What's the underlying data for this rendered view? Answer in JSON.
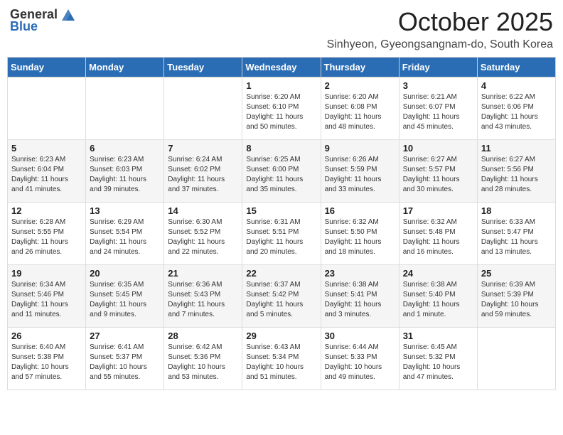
{
  "header": {
    "logo_general": "General",
    "logo_blue": "Blue",
    "month": "October 2025",
    "location": "Sinhyeon, Gyeongsangnam-do, South Korea"
  },
  "days_of_week": [
    "Sunday",
    "Monday",
    "Tuesday",
    "Wednesday",
    "Thursday",
    "Friday",
    "Saturday"
  ],
  "weeks": [
    [
      {
        "day": "",
        "info": ""
      },
      {
        "day": "",
        "info": ""
      },
      {
        "day": "",
        "info": ""
      },
      {
        "day": "1",
        "info": "Sunrise: 6:20 AM\nSunset: 6:10 PM\nDaylight: 11 hours\nand 50 minutes."
      },
      {
        "day": "2",
        "info": "Sunrise: 6:20 AM\nSunset: 6:08 PM\nDaylight: 11 hours\nand 48 minutes."
      },
      {
        "day": "3",
        "info": "Sunrise: 6:21 AM\nSunset: 6:07 PM\nDaylight: 11 hours\nand 45 minutes."
      },
      {
        "day": "4",
        "info": "Sunrise: 6:22 AM\nSunset: 6:06 PM\nDaylight: 11 hours\nand 43 minutes."
      }
    ],
    [
      {
        "day": "5",
        "info": "Sunrise: 6:23 AM\nSunset: 6:04 PM\nDaylight: 11 hours\nand 41 minutes."
      },
      {
        "day": "6",
        "info": "Sunrise: 6:23 AM\nSunset: 6:03 PM\nDaylight: 11 hours\nand 39 minutes."
      },
      {
        "day": "7",
        "info": "Sunrise: 6:24 AM\nSunset: 6:02 PM\nDaylight: 11 hours\nand 37 minutes."
      },
      {
        "day": "8",
        "info": "Sunrise: 6:25 AM\nSunset: 6:00 PM\nDaylight: 11 hours\nand 35 minutes."
      },
      {
        "day": "9",
        "info": "Sunrise: 6:26 AM\nSunset: 5:59 PM\nDaylight: 11 hours\nand 33 minutes."
      },
      {
        "day": "10",
        "info": "Sunrise: 6:27 AM\nSunset: 5:57 PM\nDaylight: 11 hours\nand 30 minutes."
      },
      {
        "day": "11",
        "info": "Sunrise: 6:27 AM\nSunset: 5:56 PM\nDaylight: 11 hours\nand 28 minutes."
      }
    ],
    [
      {
        "day": "12",
        "info": "Sunrise: 6:28 AM\nSunset: 5:55 PM\nDaylight: 11 hours\nand 26 minutes."
      },
      {
        "day": "13",
        "info": "Sunrise: 6:29 AM\nSunset: 5:54 PM\nDaylight: 11 hours\nand 24 minutes."
      },
      {
        "day": "14",
        "info": "Sunrise: 6:30 AM\nSunset: 5:52 PM\nDaylight: 11 hours\nand 22 minutes."
      },
      {
        "day": "15",
        "info": "Sunrise: 6:31 AM\nSunset: 5:51 PM\nDaylight: 11 hours\nand 20 minutes."
      },
      {
        "day": "16",
        "info": "Sunrise: 6:32 AM\nSunset: 5:50 PM\nDaylight: 11 hours\nand 18 minutes."
      },
      {
        "day": "17",
        "info": "Sunrise: 6:32 AM\nSunset: 5:48 PM\nDaylight: 11 hours\nand 16 minutes."
      },
      {
        "day": "18",
        "info": "Sunrise: 6:33 AM\nSunset: 5:47 PM\nDaylight: 11 hours\nand 13 minutes."
      }
    ],
    [
      {
        "day": "19",
        "info": "Sunrise: 6:34 AM\nSunset: 5:46 PM\nDaylight: 11 hours\nand 11 minutes."
      },
      {
        "day": "20",
        "info": "Sunrise: 6:35 AM\nSunset: 5:45 PM\nDaylight: 11 hours\nand 9 minutes."
      },
      {
        "day": "21",
        "info": "Sunrise: 6:36 AM\nSunset: 5:43 PM\nDaylight: 11 hours\nand 7 minutes."
      },
      {
        "day": "22",
        "info": "Sunrise: 6:37 AM\nSunset: 5:42 PM\nDaylight: 11 hours\nand 5 minutes."
      },
      {
        "day": "23",
        "info": "Sunrise: 6:38 AM\nSunset: 5:41 PM\nDaylight: 11 hours\nand 3 minutes."
      },
      {
        "day": "24",
        "info": "Sunrise: 6:38 AM\nSunset: 5:40 PM\nDaylight: 11 hours\nand 1 minute."
      },
      {
        "day": "25",
        "info": "Sunrise: 6:39 AM\nSunset: 5:39 PM\nDaylight: 10 hours\nand 59 minutes."
      }
    ],
    [
      {
        "day": "26",
        "info": "Sunrise: 6:40 AM\nSunset: 5:38 PM\nDaylight: 10 hours\nand 57 minutes."
      },
      {
        "day": "27",
        "info": "Sunrise: 6:41 AM\nSunset: 5:37 PM\nDaylight: 10 hours\nand 55 minutes."
      },
      {
        "day": "28",
        "info": "Sunrise: 6:42 AM\nSunset: 5:36 PM\nDaylight: 10 hours\nand 53 minutes."
      },
      {
        "day": "29",
        "info": "Sunrise: 6:43 AM\nSunset: 5:34 PM\nDaylight: 10 hours\nand 51 minutes."
      },
      {
        "day": "30",
        "info": "Sunrise: 6:44 AM\nSunset: 5:33 PM\nDaylight: 10 hours\nand 49 minutes."
      },
      {
        "day": "31",
        "info": "Sunrise: 6:45 AM\nSunset: 5:32 PM\nDaylight: 10 hours\nand 47 minutes."
      },
      {
        "day": "",
        "info": ""
      }
    ]
  ]
}
